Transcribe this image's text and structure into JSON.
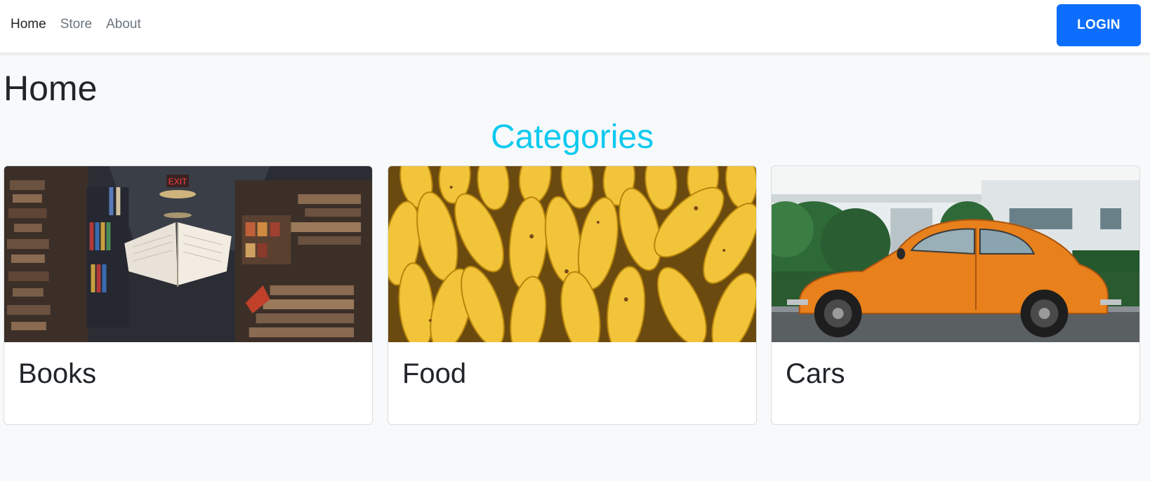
{
  "nav": {
    "links": [
      {
        "label": "Home",
        "active": true
      },
      {
        "label": "Store",
        "active": false
      },
      {
        "label": "About",
        "active": false
      }
    ],
    "login_label": "LOGIN"
  },
  "page": {
    "title": "Home",
    "section_title": "Categories"
  },
  "categories": [
    {
      "title": "Books",
      "image": "library-with-floating-open-book"
    },
    {
      "title": "Food",
      "image": "pile-of-bananas"
    },
    {
      "title": "Cars",
      "image": "orange-vintage-beetle-car"
    }
  ],
  "colors": {
    "accent": "#0dcaf0",
    "primary": "#0d6efd",
    "background": "#f8f9fa"
  }
}
